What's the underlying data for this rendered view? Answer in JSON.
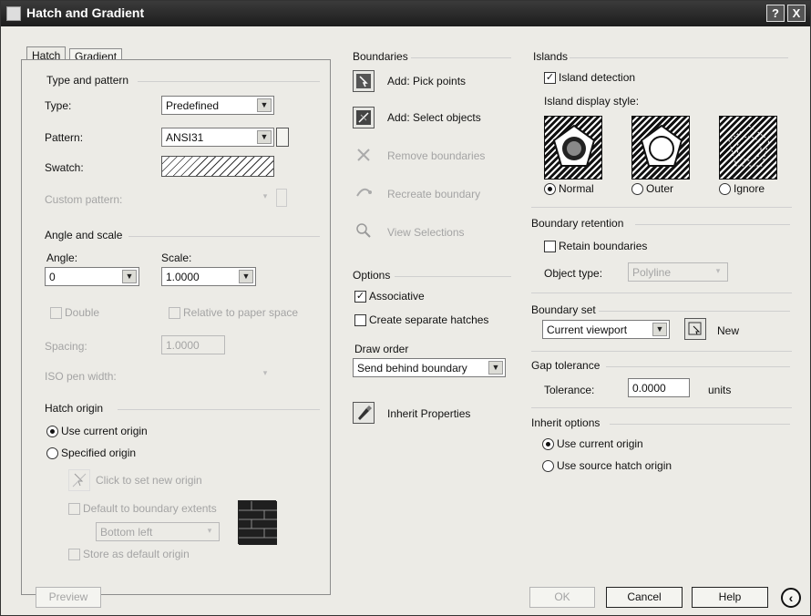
{
  "window": {
    "title": "Hatch and Gradient",
    "help_btn": "?",
    "close_btn": "X"
  },
  "tabs": {
    "hatch": "Hatch",
    "gradient": "Gradient"
  },
  "type_pattern": {
    "group": "Type and pattern",
    "type_label": "Type:",
    "type_value": "Predefined",
    "pattern_label": "Pattern:",
    "pattern_value": "ANSI31",
    "swatch_label": "Swatch:",
    "custom_label": "Custom pattern:"
  },
  "angle_scale": {
    "group": "Angle and scale",
    "angle_label": "Angle:",
    "angle_value": "0",
    "scale_label": "Scale:",
    "scale_value": "1.0000",
    "double_label": "Double",
    "relative_label": "Relative to paper space",
    "spacing_label": "Spacing:",
    "spacing_value": "1.0000",
    "iso_label": "ISO pen width:"
  },
  "hatch_origin": {
    "group": "Hatch origin",
    "use_current": "Use current origin",
    "specified": "Specified origin",
    "click_set": "Click to set new origin",
    "default_extents": "Default to boundary extents",
    "bottom_left": "Bottom left",
    "store_default": "Store as default origin"
  },
  "boundaries": {
    "group": "Boundaries",
    "add_pick": "Add: Pick points",
    "add_select": "Add: Select objects",
    "remove": "Remove boundaries",
    "recreate": "Recreate boundary",
    "view": "View Selections"
  },
  "options": {
    "group": "Options",
    "associative": "Associative",
    "separate": "Create separate hatches",
    "draw_order_label": "Draw order",
    "draw_order_value": "Send behind boundary",
    "inherit": "Inherit Properties"
  },
  "islands": {
    "group": "Islands",
    "detection": "Island detection",
    "style_label": "Island display style:",
    "normal": "Normal",
    "outer": "Outer",
    "ignore": "Ignore"
  },
  "retention": {
    "group": "Boundary retention",
    "retain": "Retain boundaries",
    "object_type_label": "Object type:",
    "object_type_value": "Polyline"
  },
  "boundary_set": {
    "group": "Boundary set",
    "value": "Current viewport",
    "new_label": "New"
  },
  "gap": {
    "group": "Gap tolerance",
    "tol_label": "Tolerance:",
    "tol_value": "0.0000",
    "units": "units"
  },
  "inherit_opts": {
    "group": "Inherit options",
    "use_current": "Use current origin",
    "use_source": "Use source hatch origin"
  },
  "footer": {
    "preview": "Preview",
    "ok": "OK",
    "cancel": "Cancel",
    "help": "Help"
  }
}
